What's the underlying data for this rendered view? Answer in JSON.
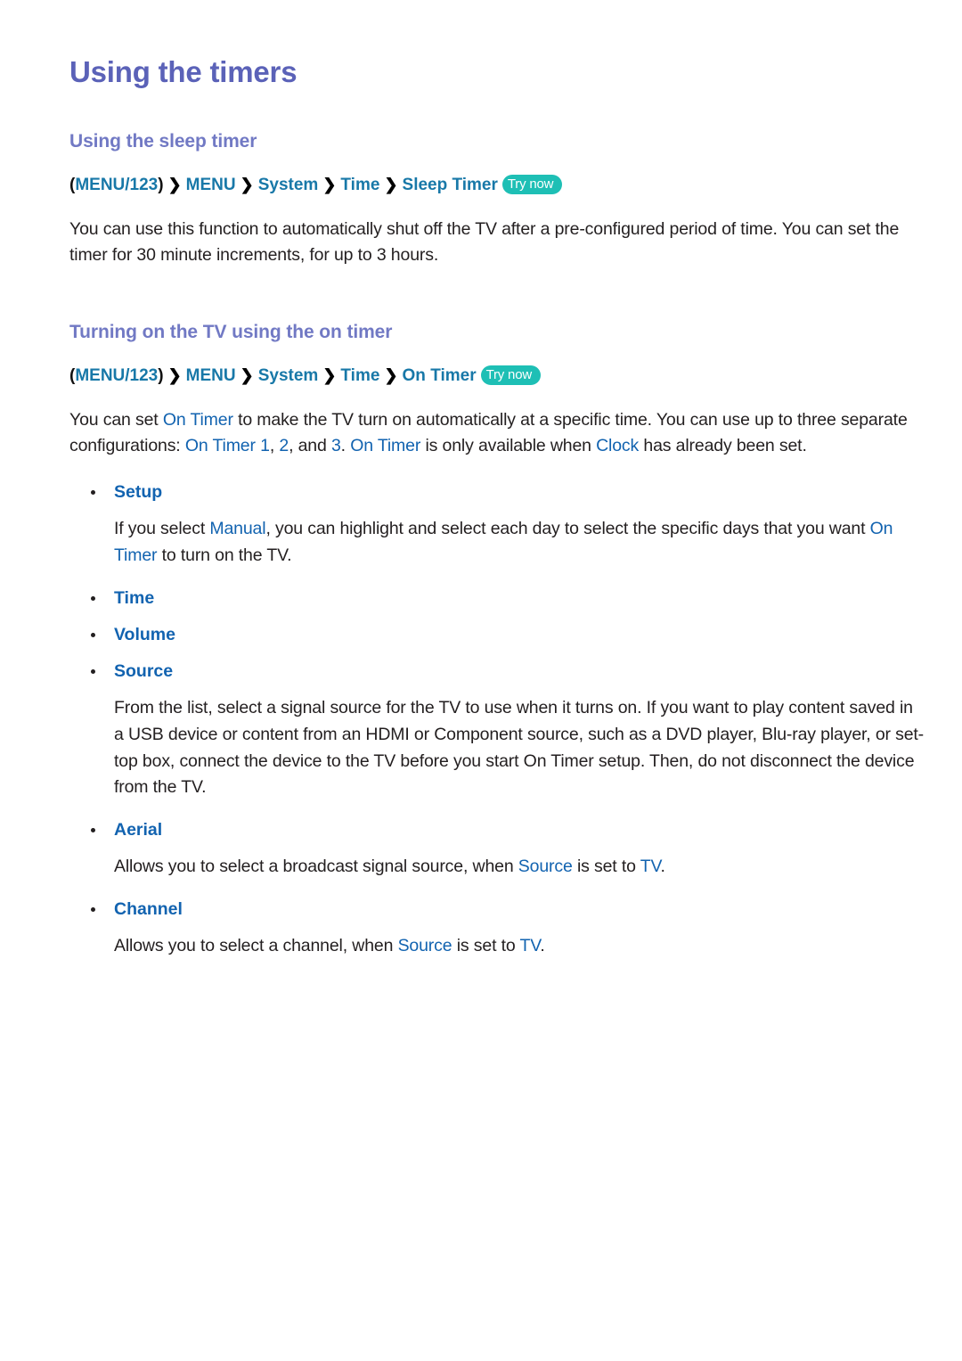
{
  "document": {
    "title": "Using the timers"
  },
  "colors": {
    "title": "#5b62b8",
    "heading": "#7179c4",
    "link": "#1263b0",
    "breadcrumb": "#1878a8",
    "badge": "#1ebfb5",
    "body": "#231f20"
  },
  "sections": [
    {
      "heading": "Using the sleep timer",
      "breadcrumb": {
        "open_paren": "(",
        "root": "MENU/123",
        "close_paren": ")",
        "separator": "❯",
        "crumbs": [
          "MENU",
          "System",
          "Time",
          "Sleep Timer"
        ],
        "badge": "Try now"
      },
      "paragraph": {
        "part1": "You can use this function to automatically shut off the TV after a pre-configured period of time. You can set the timer for 30 minute increments, for up to 3 hours."
      }
    },
    {
      "heading": "Turning on the TV using the on timer",
      "breadcrumb": {
        "open_paren": "(",
        "root": "MENU/123",
        "close_paren": ")",
        "separator": "❯",
        "crumbs": [
          "MENU",
          "System",
          "Time",
          "On Timer"
        ],
        "badge": "Try now"
      },
      "intro": {
        "t1": "You can set ",
        "l1": "On Timer",
        "t2": " to make the TV turn on automatically at a specific time. You can use up to three separate configurations: ",
        "l2": "On Timer 1",
        "t3": ", ",
        "l3": "2",
        "t4": ", and ",
        "l4": "3",
        "t5": ". ",
        "l5": "On Timer",
        "t6": " is only available when ",
        "l6": "Clock",
        "t7": " has already been set."
      }
    }
  ],
  "bullets": [
    {
      "label": "Setup",
      "description": {
        "t1": "If you select ",
        "l1": "Manual",
        "t2": ", you can highlight and select each day to select the specific days that you want ",
        "l2": "On Timer",
        "t3": " to turn on the TV."
      }
    },
    {
      "label": "Time",
      "description": null
    },
    {
      "label": "Volume",
      "description": null
    },
    {
      "label": "Source",
      "description": {
        "t1": "From the list, select a signal source for the TV to use when it turns on. If you want to play content saved in a USB device or content from an HDMI or Component source, such as a DVD player, Blu-ray player, or set-top box, connect the device to the TV before you start On Timer setup. Then, do not disconnect the device from the TV."
      }
    },
    {
      "label": "Aerial",
      "description": {
        "t1": "Allows you to select a broadcast signal source, when ",
        "l1": "Source",
        "t2": " is set to ",
        "l2": "TV",
        "t3": "."
      }
    },
    {
      "label": "Channel",
      "description": {
        "t1": "Allows you to select a channel, when ",
        "l1": "Source",
        "t2": " is set to ",
        "l2": "TV",
        "t3": "."
      }
    }
  ]
}
